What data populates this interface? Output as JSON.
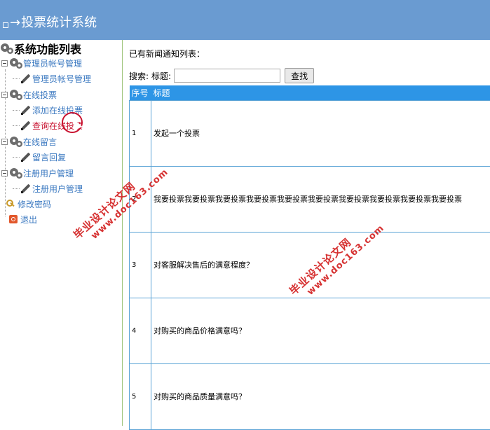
{
  "header": {
    "title": "投票统计系统"
  },
  "sidebar": {
    "title": "系统功能列表",
    "groups": [
      {
        "label": "管理员帐号管理",
        "children": [
          "管理员帐号管理"
        ]
      },
      {
        "label": "在线投票",
        "children": [
          "添加在线投票",
          "查询在线投票"
        ]
      },
      {
        "label": "在线留言",
        "children": [
          "留言回复"
        ]
      },
      {
        "label": "注册用户管理",
        "children": [
          "注册用户管理"
        ]
      }
    ],
    "change_password": "修改密码",
    "logout": "退出"
  },
  "main": {
    "list_title": "已有新闻通知列表：",
    "search_label": "搜索:",
    "title_label": "标题:",
    "search_value": "",
    "search_button": "查找",
    "table": {
      "columns": [
        "序号",
        "标题"
      ],
      "rows": [
        {
          "no": "1",
          "title": "发起一个投票"
        },
        {
          "no": "2",
          "title": "我要投票我要投票我要投票我要投票我要投票我要投票我要投票我要投票我要投票我要投票"
        },
        {
          "no": "3",
          "title": "对客服解决售后的满意程度？"
        },
        {
          "no": "4",
          "title": "对购买的商品价格满意吗？"
        },
        {
          "no": "5",
          "title": "对购买的商品质量满意吗？"
        }
      ]
    }
  },
  "watermarks": [
    {
      "line1": "毕业设计论文网",
      "line2": "www.doc163.com"
    },
    {
      "line1": "毕业设计论文网",
      "line2": "www.doc163.com"
    }
  ]
}
